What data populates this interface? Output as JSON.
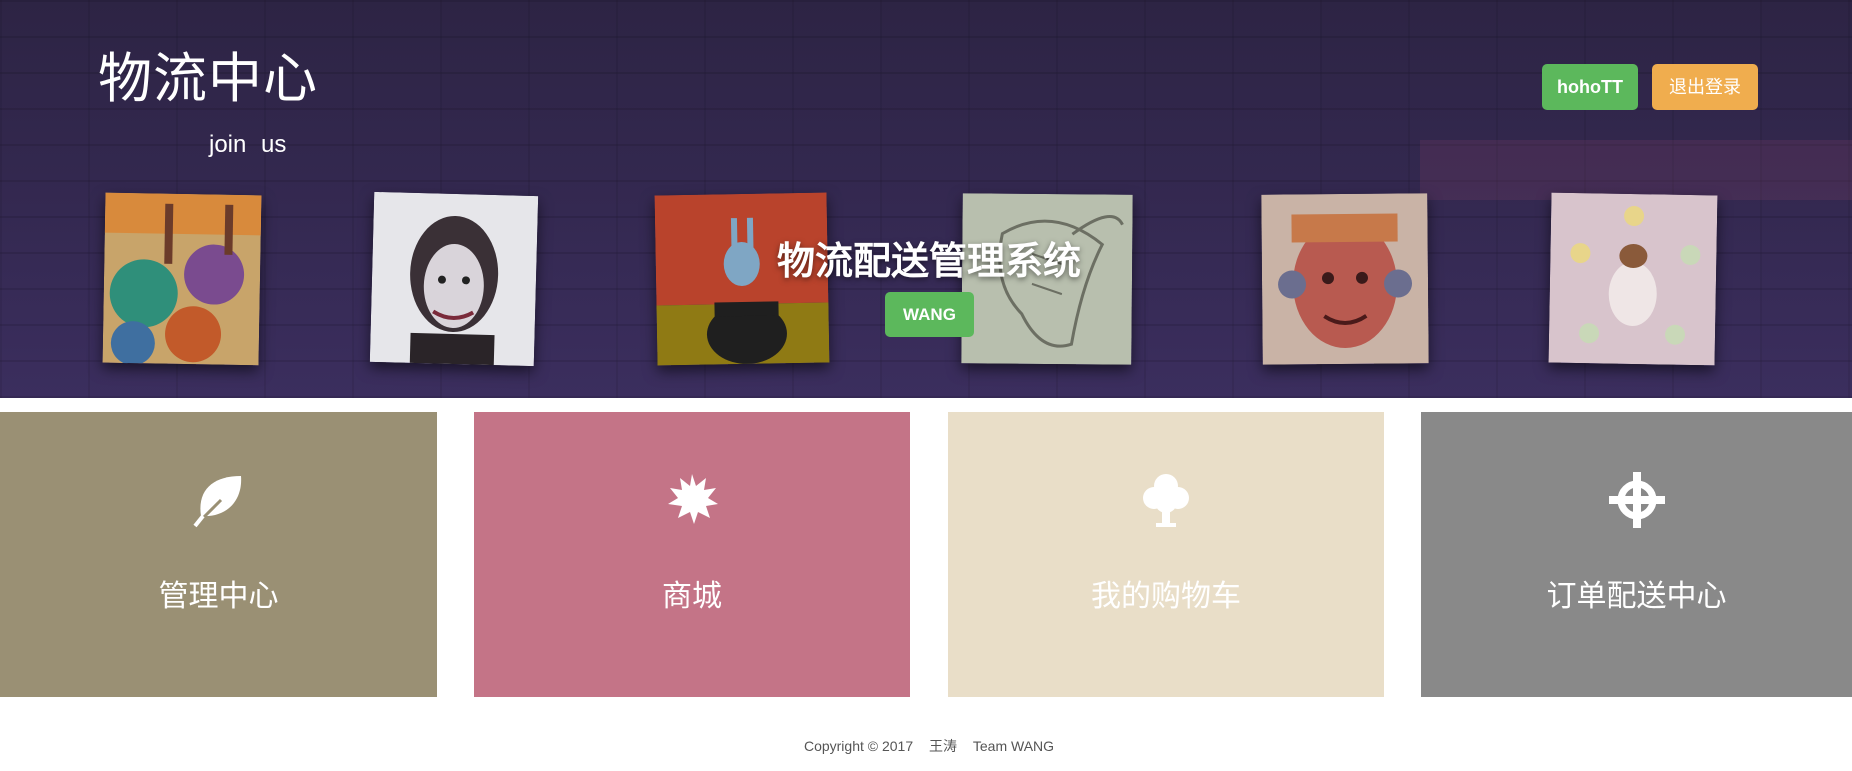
{
  "header": {
    "brand": "物流中心",
    "tagline": "join  us",
    "user_button": "hohoTT",
    "logout_button": "退出登录"
  },
  "hero": {
    "title": "物流配送管理系统",
    "badge_button": "WANG"
  },
  "tiles": [
    {
      "label": "管理中心",
      "icon": "leaf-icon",
      "color": "#9a9074"
    },
    {
      "label": "商城",
      "icon": "starburst-icon",
      "color": "#c47487"
    },
    {
      "label": "我的购物车",
      "icon": "tree-icon",
      "color": "#e9dec8"
    },
    {
      "label": "订单配送中心",
      "icon": "crosshair-icon",
      "color": "#898989"
    }
  ],
  "footer": {
    "copyright": "Copyright © 2017",
    "author": "王涛",
    "team": "Team WANG"
  },
  "colors": {
    "hero_bg": "#33284f",
    "success": "#5cb85c",
    "warning": "#f0ad4e"
  }
}
